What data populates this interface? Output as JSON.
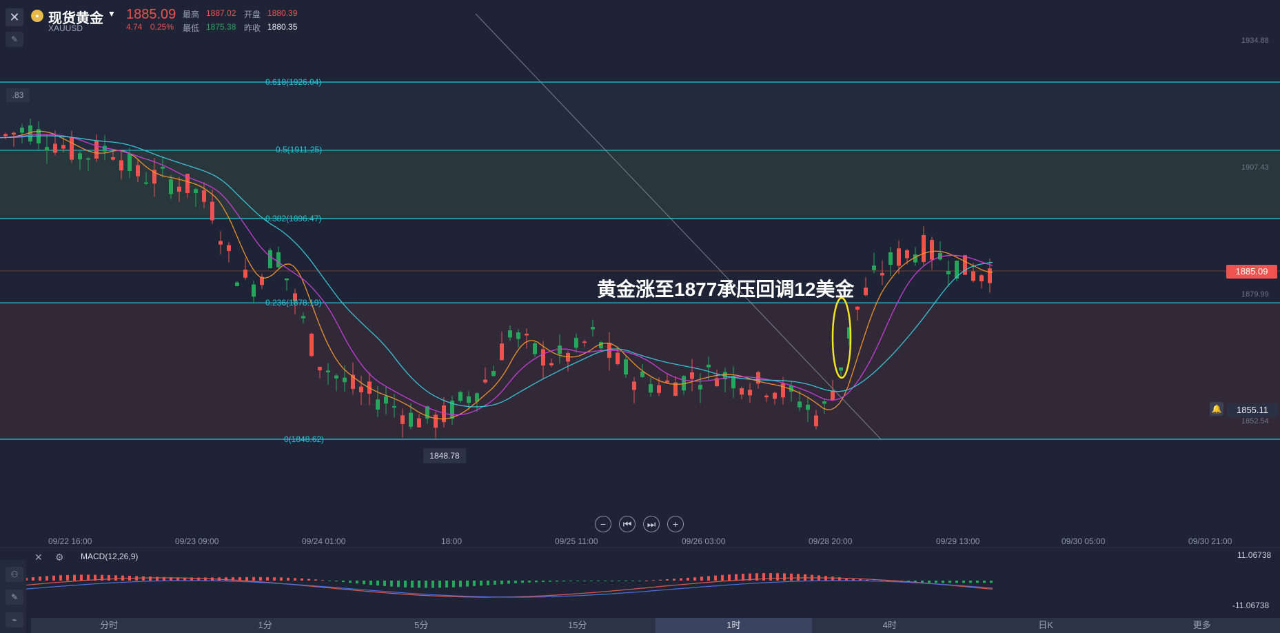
{
  "header": {
    "close_icon": "close-icon",
    "draw_icon": "draw-tool-icon",
    "name": "现货黄金",
    "symbol": "XAUUSD",
    "price": "1885.09",
    "change": "4.74",
    "change_pct": "0.25%",
    "high_label": "最高",
    "high": "1887.02",
    "open_label": "开盘",
    "open": "1880.39",
    "low_label": "最低",
    "low": "1875.38",
    "prev_label": "昨收",
    "prev_close": "1880.35"
  },
  "annotation": "黄金涨至1877承压回调12美金",
  "price_tag": "1885.09",
  "alert_price": "1855.11",
  "low_marker": "1848.78",
  "left_tag": ".83",
  "fib": [
    {
      "label": "0.618(1926.04)",
      "value": 1926.04
    },
    {
      "label": "0.5(1911.25)",
      "value": 1911.25
    },
    {
      "label": "0.382(1896.47)",
      "value": 1896.47
    },
    {
      "label": "0.236(1878.19)",
      "value": 1878.19
    },
    {
      "label": "0(1848.62)",
      "value": 1848.62
    }
  ],
  "right_axis": [
    "1934.88",
    "1907.43",
    "1879.99",
    "1852.54"
  ],
  "time_axis": [
    "09/22 16:00",
    "09/23 09:00",
    "09/24 01:00",
    "18:00",
    "09/25 11:00",
    "09/26 03:00",
    "09/28 20:00",
    "09/29 13:00",
    "09/30 05:00",
    "09/30 21:00"
  ],
  "controls": [
    "−",
    "⏮",
    "⏭",
    "+"
  ],
  "macd": {
    "label": "MACD(12,26,9)",
    "top": "11.06738",
    "bottom": "-11.06738"
  },
  "tabs": [
    "分时",
    "1分",
    "5分",
    "15分",
    "1时",
    "4时",
    "日K",
    "更多"
  ],
  "active_tab": "1时",
  "colors": {
    "bg": "#1e2436",
    "up": "#ef5350",
    "down": "#26a65b",
    "fib_line": "#26c6da",
    "ma_fast": "#f0922b",
    "ma_mid": "#c93dd8",
    "ma_slow": "#39c3d6",
    "macd_dif": "#e0594d",
    "macd_dea": "#4d6ee0",
    "highlight": "#f3e51f"
  }
}
